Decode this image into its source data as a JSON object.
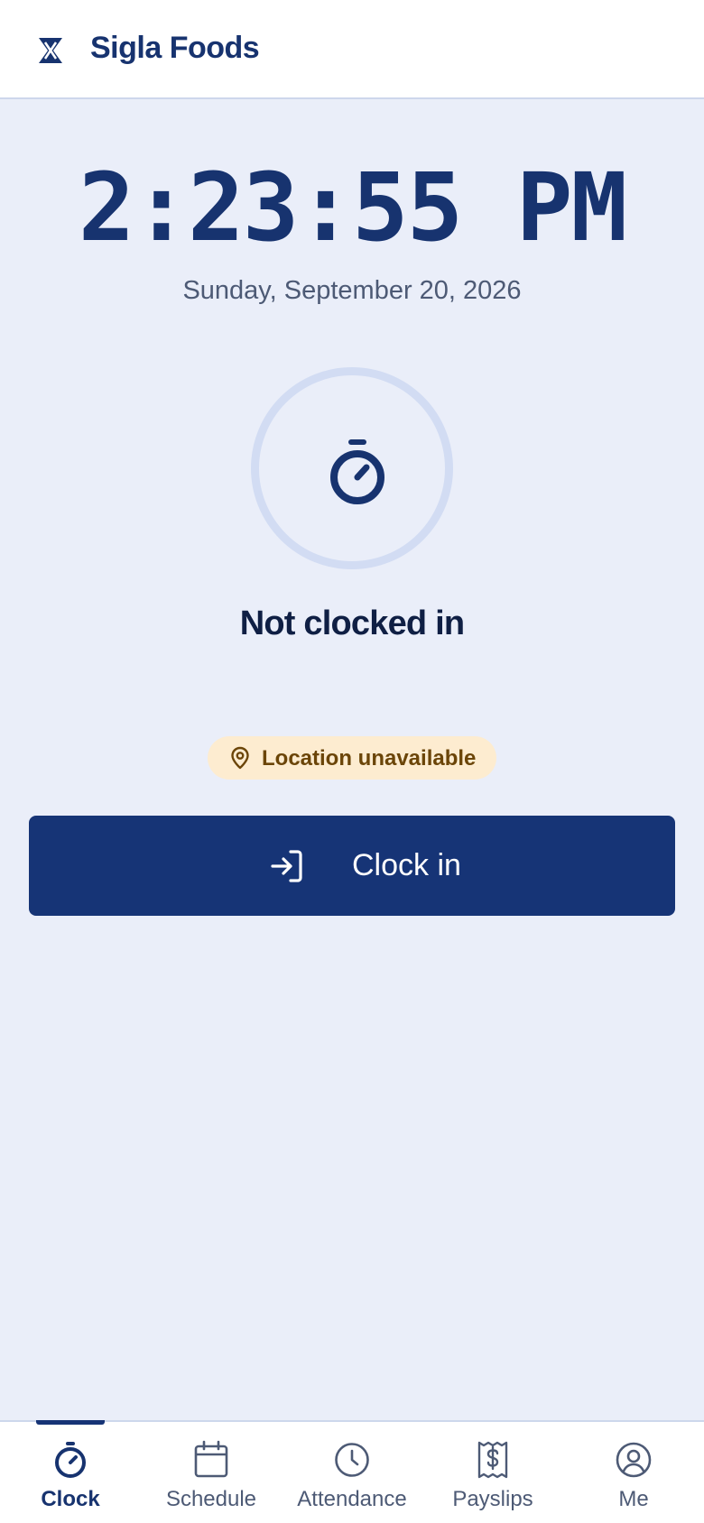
{
  "app": {
    "brand": "Sigla Foods",
    "logo_icon": "hourglass-x-icon"
  },
  "clock": {
    "time": "2:23:55 PM",
    "date": "Sunday, September 20, 2026",
    "timer_icon": "stopwatch-icon",
    "status": "Not clocked in"
  },
  "location": {
    "icon": "map-pin-icon",
    "text": "Location unavailable"
  },
  "action": {
    "icon": "sign-in-arrow-icon",
    "label": "Clock in"
  },
  "tabs": [
    {
      "label": "Clock",
      "icon": "stopwatch-icon",
      "active": true
    },
    {
      "label": "Schedule",
      "icon": "calendar-icon",
      "active": false
    },
    {
      "label": "Attendance",
      "icon": "clock-icon",
      "active": false
    },
    {
      "label": "Payslips",
      "icon": "receipt-dollar-icon",
      "active": false
    },
    {
      "label": "Me",
      "icon": "user-circle-icon",
      "active": false
    }
  ],
  "colors": {
    "brand": "#17336f",
    "button": "#163476",
    "background": "#eaeef9",
    "badge_bg": "#fdecd0",
    "badge_text": "#6b4508"
  }
}
